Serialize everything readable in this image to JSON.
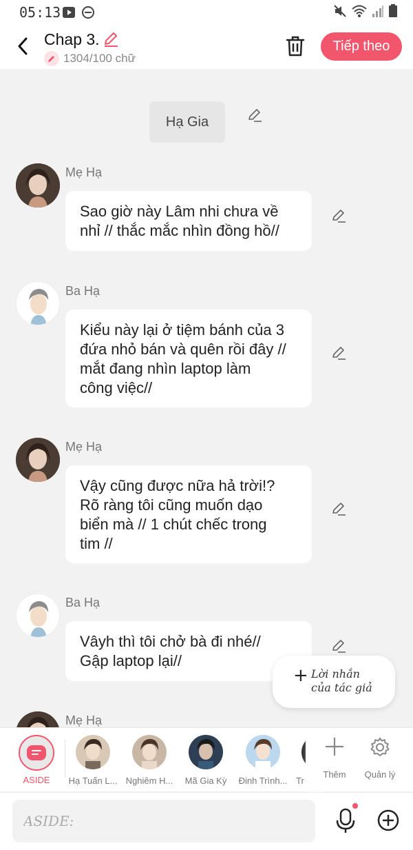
{
  "status_bar": {
    "time": "05:13"
  },
  "header": {
    "chapter_title": "Chap 3.",
    "word_count": "1304/100 chữ",
    "next_label": "Tiếp theo"
  },
  "narration": {
    "label": "Hạ Gia"
  },
  "messages": [
    {
      "speaker": "Mẹ Hạ",
      "text": "Sao giờ này Lâm nhi chưa về\nnhỉ // thắc mắc nhìn đồng hồ//"
    },
    {
      "speaker": "Ba Hạ",
      "text": "Kiểu này lại ở tiệm bánh của 3\nđứa nhỏ bán và quên rồi đây //\nmắt đang nhìn laptop làm\ncông việc//"
    },
    {
      "speaker": "Mẹ Hạ",
      "text": "Vậy cũng được nữa hả trời!?\nRõ ràng tôi cũng muốn dạo\nbiển mà // 1 chút chếc trong\ntim //"
    },
    {
      "speaker": "Ba Hạ",
      "text": "Vâyh thì tôi chở bà đi nhé//\nGập laptop lại//"
    },
    {
      "speaker": "Mẹ Hạ",
      "text": ""
    }
  ],
  "author_note": {
    "label": "Lời nhắn\ncủa tác giả"
  },
  "character_bar": {
    "aside_label": "ASIDE",
    "characters": [
      "Hạ Tuấn L...",
      "Nghiêm H...",
      "Mã Gia Kỳ",
      "Đinh Trình...",
      "Tr"
    ],
    "add_label": "Thêm",
    "manage_label": "Quản lý"
  },
  "input": {
    "placeholder": "ASIDE:"
  },
  "colors": {
    "accent": "#f2566d",
    "background": "#f2f2f2"
  }
}
